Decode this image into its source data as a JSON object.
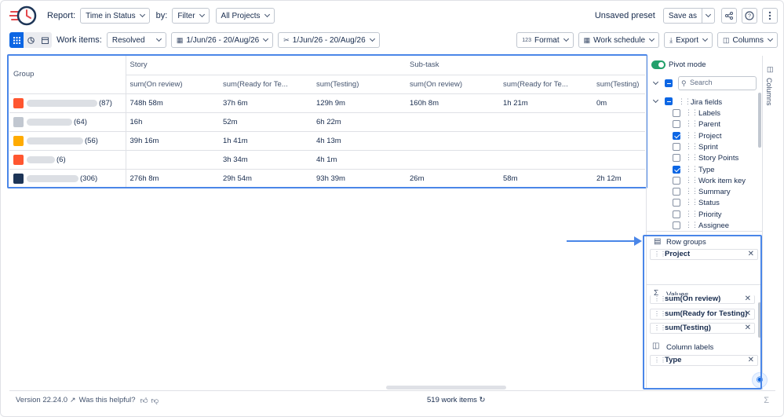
{
  "header": {
    "report_label": "Report:",
    "report_value": "Time in Status",
    "by_label": "by:",
    "filter_value": "Filter",
    "projects_value": "All Projects",
    "unsaved": "Unsaved preset",
    "save_as": "Save as"
  },
  "toolbar": {
    "work_items_label": "Work items:",
    "work_items_value": "Resolved",
    "date1": "1/Jun/26 - 20/Aug/26",
    "date2": "1/Jun/26 - 20/Aug/26",
    "format": "Format",
    "format_prefix": "123",
    "work_schedule": "Work schedule",
    "export": "Export",
    "columns": "Columns"
  },
  "table": {
    "group_header": "Group",
    "story_header": "Story",
    "subtask_header": "Sub-task",
    "columns": [
      "sum(On review)",
      "sum(Ready for Te...",
      "sum(Testing)",
      "sum(On review)",
      "sum(Ready for Te...",
      "sum(Testing)"
    ],
    "rows": [
      {
        "count": "(87)",
        "icon_color": "#ff5630",
        "blur_w": 90,
        "cells": [
          "748h 58m",
          "37h 6m",
          "129h 9m",
          "160h 8m",
          "1h 21m",
          "0m"
        ]
      },
      {
        "count": "(64)",
        "icon_color": "#c1c7d0",
        "blur_w": 58,
        "cells": [
          "16h",
          "52m",
          "6h 22m",
          "",
          "",
          ""
        ]
      },
      {
        "count": "(56)",
        "icon_color": "#ffab00",
        "blur_w": 72,
        "cells": [
          "39h 16m",
          "1h 41m",
          "4h 13m",
          "",
          "",
          ""
        ]
      },
      {
        "count": "(6)",
        "icon_color": "#ff5630",
        "blur_w": 36,
        "cells": [
          "",
          "3h 34m",
          "4h 1m",
          "",
          "",
          ""
        ]
      },
      {
        "count": "(306)",
        "icon_color": "#1d3557",
        "blur_w": 66,
        "cells": [
          "276h 8m",
          "29h 54m",
          "93h 39m",
          "26m",
          "58m",
          "2h 12m"
        ]
      }
    ]
  },
  "footer": {
    "version": "Version 22.24.0",
    "helpful": "Was this helpful?",
    "work_items": "519 work items"
  },
  "panel": {
    "pivot_label": "Pivot mode",
    "search_placeholder": "Search",
    "jira_fields": "Jira fields",
    "fields": [
      {
        "label": "Labels",
        "checked": false
      },
      {
        "label": "Parent",
        "checked": false
      },
      {
        "label": "Project",
        "checked": true
      },
      {
        "label": "Sprint",
        "checked": false
      },
      {
        "label": "Story Points",
        "checked": false
      },
      {
        "label": "Type",
        "checked": true
      },
      {
        "label": "Work item key",
        "checked": false
      },
      {
        "label": "Summary",
        "checked": false
      },
      {
        "label": "Status",
        "checked": false
      },
      {
        "label": "Priority",
        "checked": false
      },
      {
        "label": "Assignee",
        "checked": false
      }
    ],
    "row_groups_title": "Row groups",
    "row_groups": [
      "Project"
    ],
    "values_title": "Values",
    "values": [
      "sum(On review)",
      "sum(Ready for Testing)",
      "sum(Testing)"
    ],
    "column_labels_title": "Column labels",
    "column_labels": [
      "Type"
    ],
    "vertical_tab": "Columns"
  },
  "colors": {
    "accent": "#0c66e4",
    "highlight": "#4a86e8",
    "toggle_on": "#22a06b"
  }
}
